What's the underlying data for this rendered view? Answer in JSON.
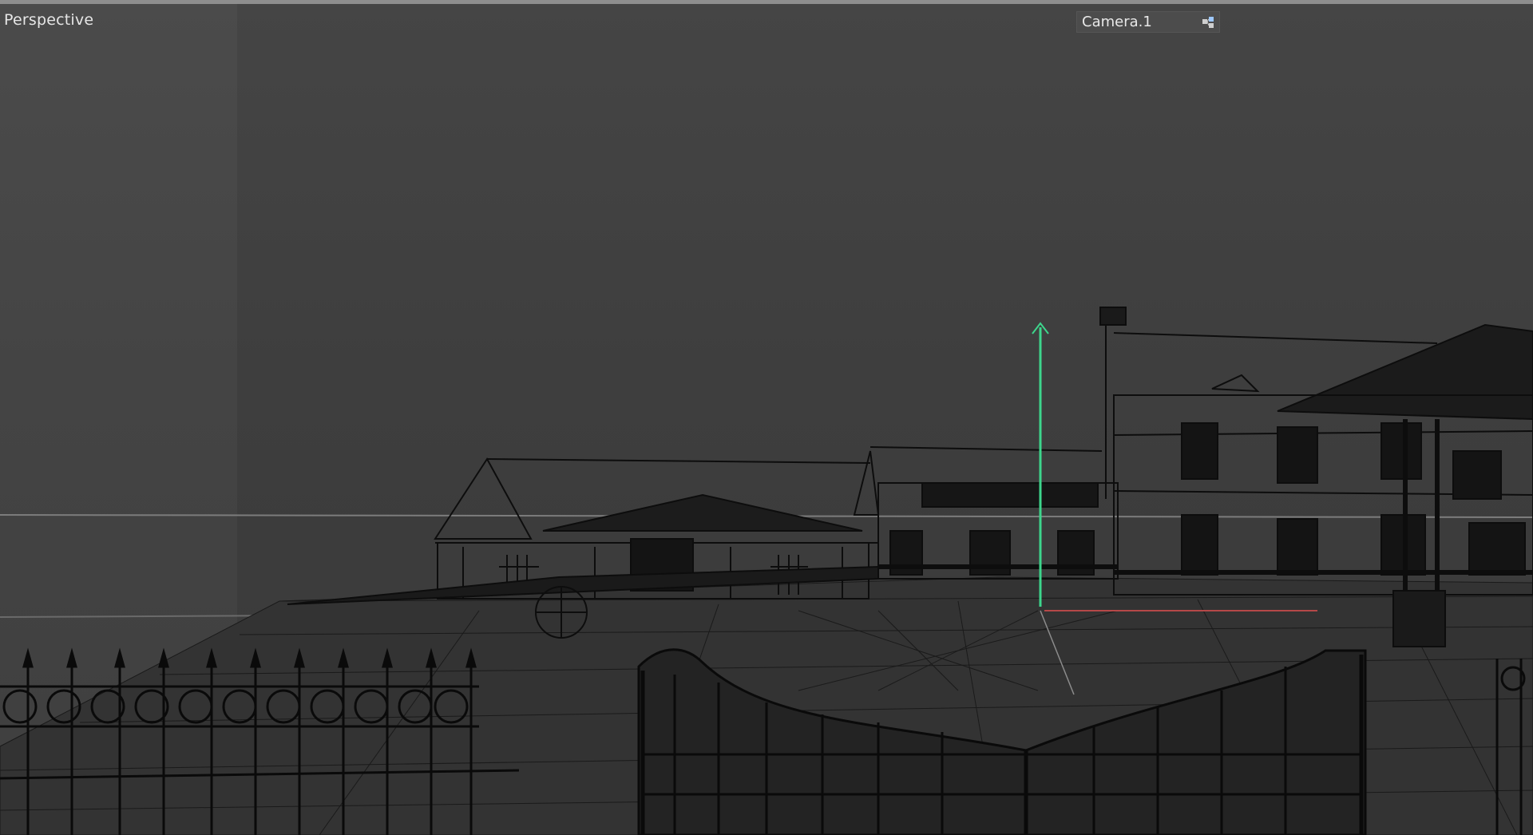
{
  "viewport": {
    "view_name": "Perspective",
    "camera": {
      "label": "Camera.1",
      "icon": "camera-link-icon"
    },
    "gizmo": {
      "y_axis_color": "#3dd68c",
      "x_axis_color": "#c0392b"
    },
    "scene": "wireframe-mansion-with-gates-and-fence"
  },
  "colors": {
    "background": "#3e3e3e",
    "wire": "#111111",
    "horizon": "#7a7a7a"
  }
}
